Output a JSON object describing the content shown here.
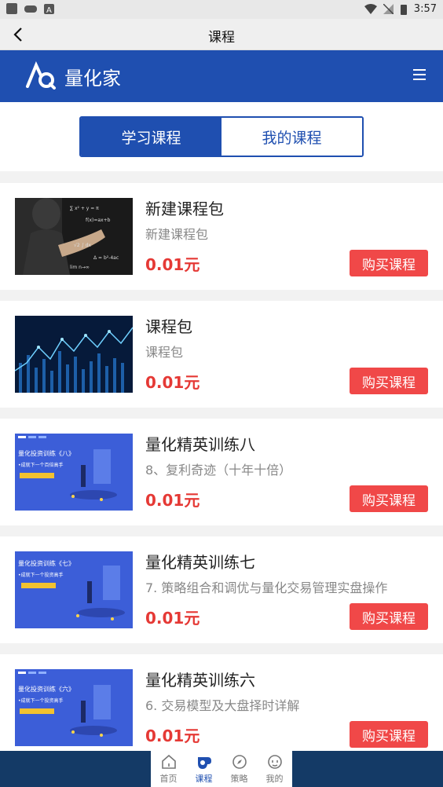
{
  "status_bar": {
    "time": "3:57"
  },
  "title_bar": {
    "title": "课程"
  },
  "app_bar": {
    "brand": "量化家"
  },
  "tabs": [
    {
      "label": "学习课程",
      "active": true
    },
    {
      "label": "我的课程",
      "active": false
    }
  ],
  "courses": [
    {
      "title": "新建课程包",
      "subtitle": "新建课程包",
      "price": "0.01元",
      "button": "购买课程",
      "thumb": "businessman-touching-screen"
    },
    {
      "title": "课程包",
      "subtitle": "课程包",
      "price": "0.01元",
      "button": "购买课程",
      "thumb": "stock-chart"
    },
    {
      "title": "量化精英训练八",
      "subtitle": "8、复利奇迹（十年十倍）",
      "price": "0.01元",
      "button": "购买课程",
      "thumb": "training-banner",
      "thumb_text": "量化投资训练《八》",
      "thumb_sub": "•成就下一个百倍高手"
    },
    {
      "title": "量化精英训练七",
      "subtitle": "7. 策略组合和调优与量化交易管理实盘操作",
      "price": "0.01元",
      "button": "购买课程",
      "thumb": "training-banner",
      "thumb_text": "量化投资训练《七》",
      "thumb_sub": "•成就下一个投资高手"
    },
    {
      "title": "量化精英训练六",
      "subtitle": "6. 交易模型及大盘择时详解",
      "price": "0.01元",
      "button": "购买课程",
      "thumb": "training-banner",
      "thumb_text": "量化投资训练《六》",
      "thumb_sub": "•成就下一个投资高手"
    }
  ],
  "bottom_nav": [
    {
      "label": "首页",
      "icon": "home-icon",
      "active": false
    },
    {
      "label": "课程",
      "icon": "course-icon",
      "active": true
    },
    {
      "label": "策略",
      "icon": "compass-icon",
      "active": false
    },
    {
      "label": "我的",
      "icon": "profile-icon",
      "active": false
    }
  ],
  "colors": {
    "primary": "#1f4fb0",
    "price": "#e53935",
    "buy_button": "#f04848",
    "nav_bg": "#143a66"
  }
}
